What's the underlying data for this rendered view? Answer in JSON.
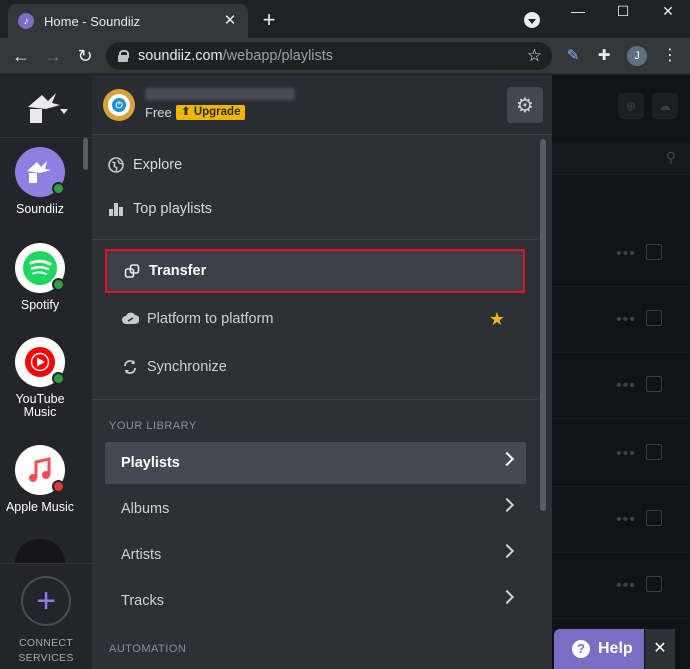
{
  "browser": {
    "tab_title": "Home - Soundiiz",
    "tab_close": "✕",
    "new_tab": "+",
    "url_host": "soundiiz.com",
    "url_path": "/webapp/playlists",
    "profile_initial": "J",
    "window_minimize": "—",
    "window_maximize": "☐",
    "window_close": "✕"
  },
  "rail": {
    "services": [
      {
        "label": "Soundiiz",
        "bg": "#8f7fe0",
        "status": "#2ea043"
      },
      {
        "label": "Spotify",
        "bg": "#ffffff",
        "status": "#2ea043"
      },
      {
        "label": "YouTube Music",
        "bg": "#ffffff",
        "status": "#2ea043"
      },
      {
        "label": "Apple Music",
        "bg": "#ffffff",
        "status": "#e03a3a"
      }
    ],
    "connect_label_1": "CONNECT",
    "connect_label_2": "SERVICES",
    "connect_plus": "+"
  },
  "panel": {
    "plan": "Free",
    "upgrade_label": "⬆ Upgrade",
    "menu": [
      {
        "label": "Explore",
        "icon": "globe-icon"
      },
      {
        "label": "Top playlists",
        "icon": "bar-chart-icon"
      }
    ],
    "transfer_label": "Transfer",
    "platform_label": "Platform to platform",
    "sync_label": "Synchronize",
    "library_header": "YOUR LIBRARY",
    "library": [
      {
        "label": "Playlists",
        "active": true
      },
      {
        "label": "Albums",
        "active": false
      },
      {
        "label": "Artists",
        "active": false
      },
      {
        "label": "Tracks",
        "active": false
      }
    ],
    "automation_header": "AUTOMATION"
  },
  "help": {
    "label": "Help",
    "close": "✕"
  },
  "colors": {
    "accent": "#7b6ec2",
    "highlight_border": "#e3131f",
    "upgrade": "#f1b500"
  }
}
